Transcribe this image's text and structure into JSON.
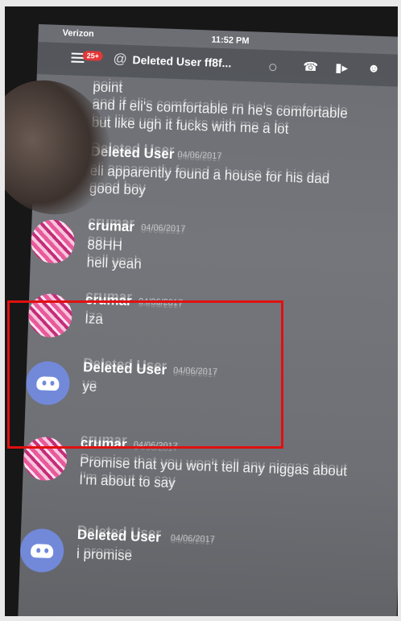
{
  "status_bar": {
    "carrier": "Verizon",
    "time": "11:52 PM"
  },
  "header": {
    "unread_badge": "25+",
    "at_symbol": "@",
    "title": "Deleted User ff8f...",
    "icons": [
      "hamburger-icon",
      "phone-icon",
      "video-icon",
      "members-icon"
    ]
  },
  "messages": [
    {
      "author": "",
      "time": "",
      "lines": [
        "point",
        "and if eli's comfortable rn he's comfortable",
        "but like ugh it fucks with me a lot"
      ]
    },
    {
      "author": "Deleted User",
      "time": "04/06/2017",
      "lines": [
        "eli apparently found a house for his dad",
        "good boy"
      ],
      "avatar": "discord"
    },
    {
      "author": "crumar",
      "time": "04/06/2017",
      "lines": [
        "88HH",
        "hell yeah"
      ],
      "avatar": "pink"
    },
    {
      "author": "crumar",
      "time": "04/06/2017",
      "lines": [
        "Iza"
      ],
      "avatar": "pink"
    },
    {
      "author": "Deleted User",
      "time": "04/06/2017",
      "lines": [
        "ye"
      ],
      "avatar": "discord"
    },
    {
      "author": "crumar",
      "time": "04/06/2017",
      "lines": [
        "Promise that you won't tell any niggas about",
        "I'm about to say"
      ],
      "avatar": "pink"
    },
    {
      "author": "Deleted User",
      "time": "04/06/2017",
      "lines": [
        "i promise"
      ],
      "avatar": "discord"
    }
  ],
  "colors": {
    "highlight": "#e01010",
    "badge": "#e23838",
    "discord_blurple": "#7289da"
  }
}
